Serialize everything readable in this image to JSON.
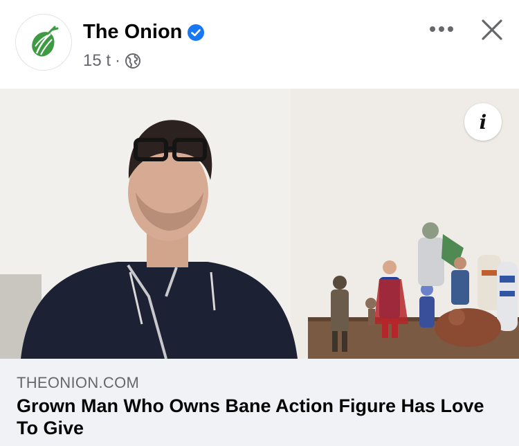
{
  "post": {
    "page_name": "The Onion",
    "timestamp": "15 t",
    "separator": "·",
    "audience_icon": "globe-icon",
    "verified_icon": "verified-badge-icon",
    "logo_icon": "onion-logo-icon",
    "more_icon": "more-options-icon",
    "close_icon": "close-icon",
    "accent_color": "#1877f2",
    "logo_color": "#3f9a44"
  },
  "link_preview": {
    "image_info_icon": "info-icon",
    "image_info_label": "i",
    "domain": "THEONION.COM",
    "headline": "Grown Man Who Owns Bane Action Figure Has Love To Give"
  }
}
